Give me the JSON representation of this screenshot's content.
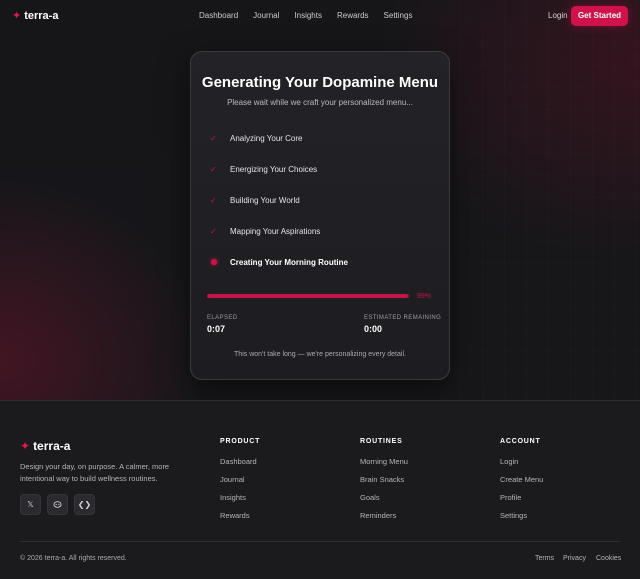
{
  "brand": {
    "name": "terra-a",
    "icon": "sparkle-icon",
    "accent": "#d0124b"
  },
  "nav": {
    "links": [
      "Dashboard",
      "Journal",
      "Insights",
      "Rewards",
      "Settings"
    ],
    "login": "Login",
    "cta": "Get Started"
  },
  "card": {
    "title": "Generating Your Dopamine Menu",
    "subtitle": "Please wait while we craft your personalized menu...",
    "steps": [
      {
        "label": "Analyzing Your Core",
        "status": "done",
        "icon": "check-icon"
      },
      {
        "label": "Energizing Your Choices",
        "status": "done",
        "icon": "check-icon"
      },
      {
        "label": "Building Your World",
        "status": "done",
        "icon": "check-icon"
      },
      {
        "label": "Mapping Your Aspirations",
        "status": "done",
        "icon": "check-icon"
      },
      {
        "label": "Creating Your Morning Routine",
        "status": "active",
        "icon": "pulse-dot-icon"
      }
    ],
    "progress_value": 99,
    "progress_text": "99%",
    "elapsed_label": "ELAPSED",
    "elapsed_value": "0:07",
    "remaining_label": "ESTIMATED REMAINING",
    "remaining_value": "0:00",
    "footnote": "This won't take long — we're personalizing every detail."
  },
  "footer": {
    "description": "Design your day, on purpose. A calmer, more intentional way to build wellness routines.",
    "socials": [
      "x-icon",
      "discord-icon",
      "code-icon"
    ],
    "columns": [
      {
        "title": "PRODUCT",
        "links": [
          "Dashboard",
          "Journal",
          "Insights",
          "Rewards"
        ]
      },
      {
        "title": "ROUTINES",
        "links": [
          "Morning Menu",
          "Brain Snacks",
          "Goals",
          "Reminders"
        ]
      },
      {
        "title": "ACCOUNT",
        "links": [
          "Login",
          "Create Menu",
          "Profile",
          "Settings"
        ]
      }
    ],
    "copyright": "© 2026 terra-a. All rights reserved.",
    "legal": [
      "Terms",
      "Privacy",
      "Cookies"
    ]
  }
}
